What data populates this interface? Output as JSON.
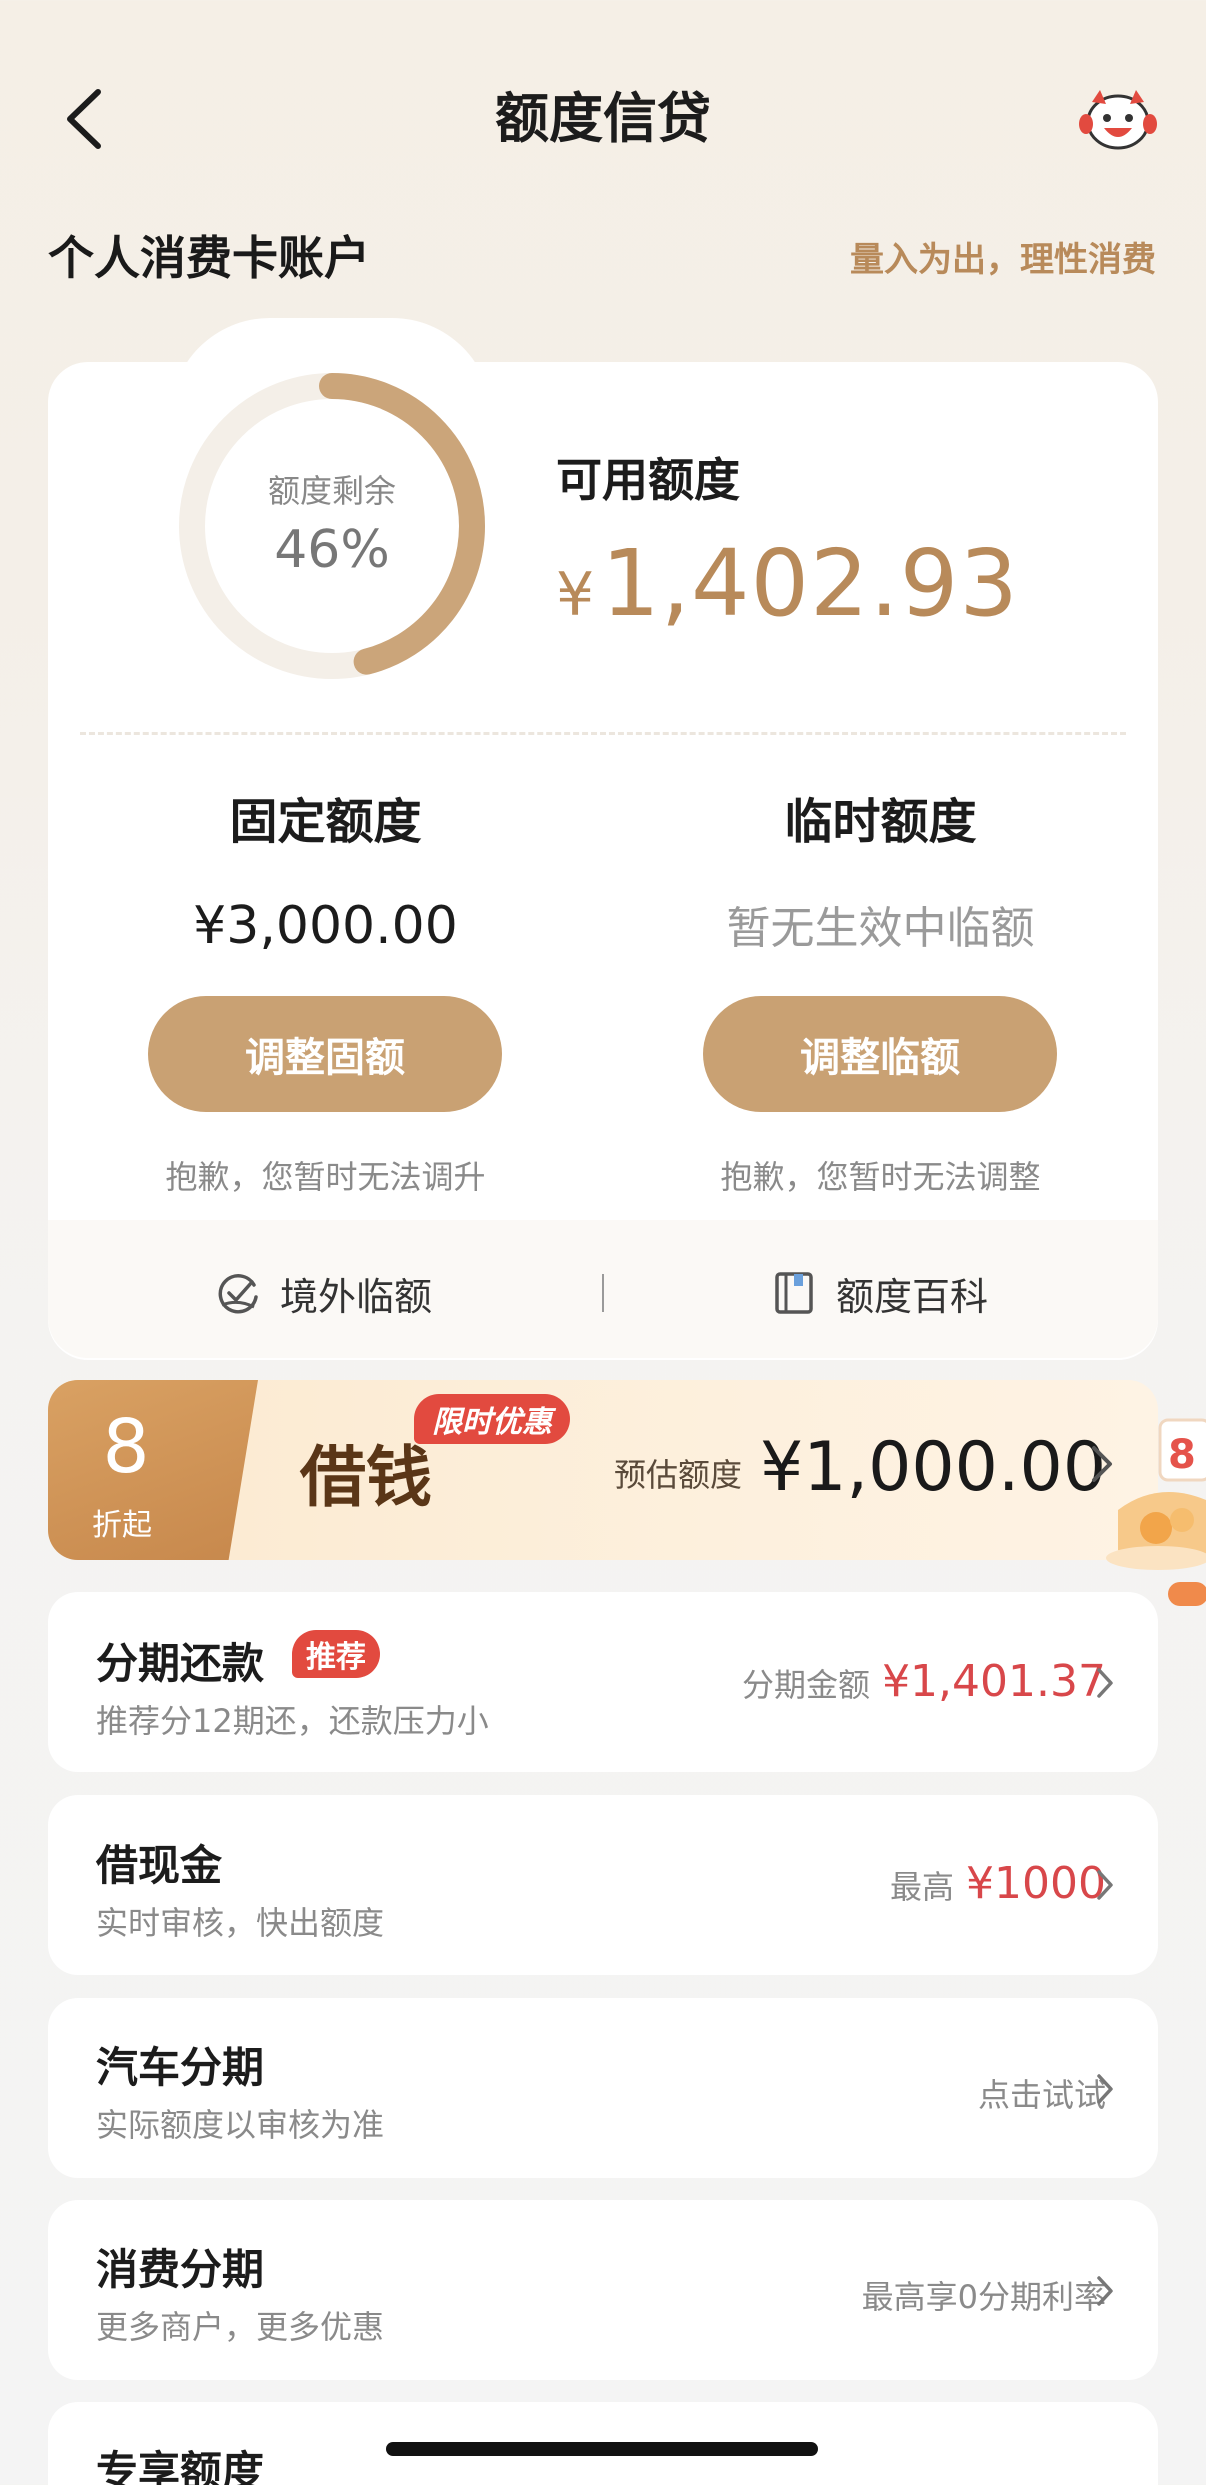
{
  "header": {
    "title": "额度信贷",
    "back_icon": "chevron-left-icon",
    "mascot_icon": "mascot-cow-icon"
  },
  "account": {
    "title": "个人消费卡账户",
    "slogan": "量入为出，理性消费"
  },
  "credit": {
    "ring_label": "额度剩余",
    "ring_percent_text": "46%",
    "ring_fraction": 0.46,
    "available_label": "可用额度",
    "currency": "¥",
    "available_amount": "1,402.93",
    "fixed": {
      "title": "固定额度",
      "amount": "¥3,000.00",
      "button": "调整固额",
      "note": "抱歉，您暂时无法调升"
    },
    "temporary": {
      "title": "临时额度",
      "empty_text": "暂无生效中临额",
      "button": "调整临额",
      "note": "抱歉，您暂时无法调整"
    },
    "links": [
      {
        "label": "境外临额",
        "icon": "overseas-check-icon"
      },
      {
        "label": "额度百科",
        "icon": "book-icon"
      }
    ]
  },
  "promo": {
    "discount_number": "8",
    "discount_unit": "折起",
    "name": "借钱",
    "tag": "限时优惠",
    "estimate_label": "预估额度",
    "estimate_amount": "¥1,000.00"
  },
  "list": [
    {
      "title": "分期还款",
      "badge": "推荐",
      "subtitle": "推荐分12期还，还款压力小",
      "right_label": "分期金额",
      "right_value": "¥1,401.37"
    },
    {
      "title": "借现金",
      "subtitle": "实时审核，快出额度",
      "right_label": "最高",
      "right_value": "¥1000"
    },
    {
      "title": "汽车分期",
      "subtitle": "实际额度以审核为准",
      "right_label": "点击试试"
    },
    {
      "title": "消费分期",
      "subtitle": "更多商户，更多优惠",
      "right_label": "最高享0分期利率"
    },
    {
      "title": "专享额度"
    }
  ],
  "colors": {
    "accent": "#c9a173",
    "gold_text": "#b88a5a",
    "red": "#d8474a"
  }
}
